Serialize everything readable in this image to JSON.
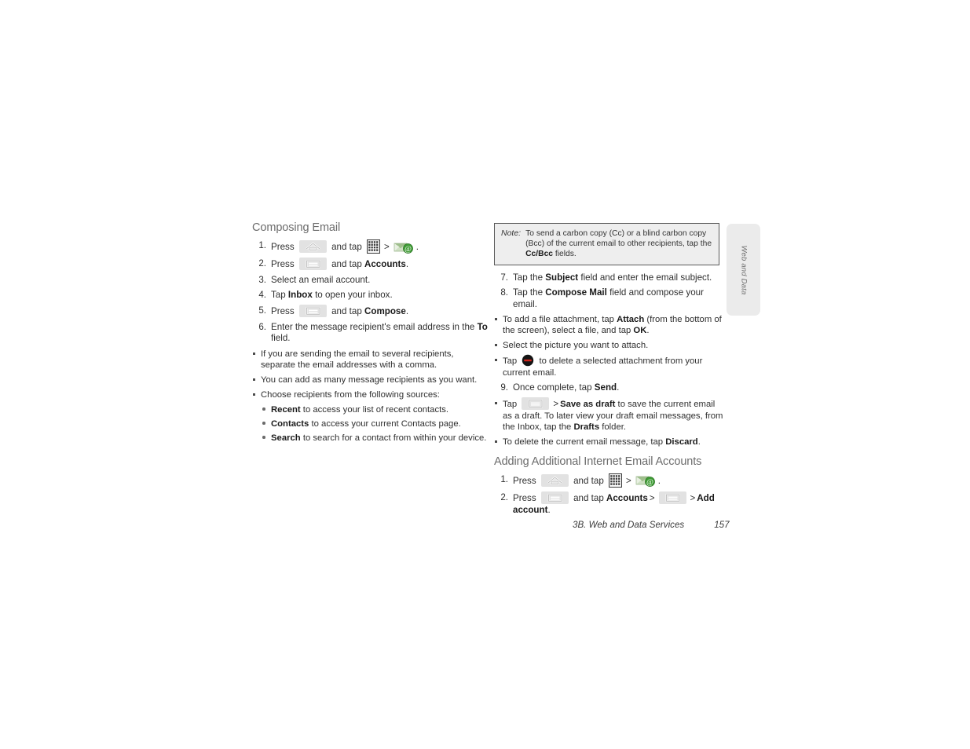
{
  "page": {
    "footer_section": "3B. Web and Data Services",
    "footer_page_number": "157",
    "side_tab_label": "Web and Data"
  },
  "left_column": {
    "heading": "Composing Email",
    "steps": [
      {
        "num": "1.",
        "parts": [
          {
            "t": "text",
            "v": "Press "
          },
          {
            "t": "icon",
            "v": "home-key-icon"
          },
          {
            "t": "text",
            "v": " and tap "
          },
          {
            "t": "icon",
            "v": "apps-grid-icon"
          },
          {
            "t": "gt",
            "v": ">"
          },
          {
            "t": "icon",
            "v": "email-icon"
          },
          {
            "t": "text",
            "v": "."
          }
        ]
      },
      {
        "num": "2.",
        "parts": [
          {
            "t": "text",
            "v": "Press "
          },
          {
            "t": "icon",
            "v": "menu-key-icon"
          },
          {
            "t": "text",
            "v": " and tap "
          },
          {
            "t": "bold",
            "v": "Accounts"
          },
          {
            "t": "text",
            "v": "."
          }
        ]
      },
      {
        "num": "3.",
        "parts": [
          {
            "t": "text",
            "v": "Select an email account."
          }
        ]
      },
      {
        "num": "4.",
        "parts": [
          {
            "t": "text",
            "v": "Tap "
          },
          {
            "t": "bold",
            "v": "Inbox"
          },
          {
            "t": "text",
            "v": " to open your inbox."
          }
        ]
      },
      {
        "num": "5.",
        "parts": [
          {
            "t": "text",
            "v": "Press "
          },
          {
            "t": "icon",
            "v": "menu-key-icon"
          },
          {
            "t": "text",
            "v": " and tap "
          },
          {
            "t": "bold",
            "v": "Compose"
          },
          {
            "t": "text",
            "v": "."
          }
        ]
      },
      {
        "num": "6.",
        "parts": [
          {
            "t": "text",
            "v": "Enter the message recipient's email address in the "
          },
          {
            "t": "bold",
            "v": "To"
          },
          {
            "t": "text",
            "v": " field."
          }
        ]
      }
    ],
    "step6_bullets": [
      {
        "parts": [
          {
            "t": "text",
            "v": "If you are sending the email to several recipients, separate the email addresses with a comma."
          }
        ]
      },
      {
        "parts": [
          {
            "t": "text",
            "v": "You can add as many message recipients as you want."
          }
        ]
      },
      {
        "parts": [
          {
            "t": "text",
            "v": "Choose recipients from the following sources:"
          }
        ]
      }
    ],
    "sources": [
      {
        "parts": [
          {
            "t": "bold",
            "v": "Recent"
          },
          {
            "t": "text",
            "v": " to access your list of recent contacts."
          }
        ]
      },
      {
        "parts": [
          {
            "t": "bold",
            "v": "Contacts"
          },
          {
            "t": "text",
            "v": " to access your current Contacts page."
          }
        ]
      },
      {
        "parts": [
          {
            "t": "bold",
            "v": "Search"
          },
          {
            "t": "text",
            "v": " to search for a contact from within your device."
          }
        ]
      }
    ]
  },
  "right_column": {
    "note": {
      "label": "Note:",
      "parts": [
        {
          "t": "text",
          "v": "To send a carbon copy (Cc) or a blind carbon copy (Bcc) of the current email to other recipients, tap the "
        },
        {
          "t": "bold",
          "v": "Cc/Bcc"
        },
        {
          "t": "text",
          "v": " fields."
        }
      ]
    },
    "steps": [
      {
        "num": "7.",
        "parts": [
          {
            "t": "text",
            "v": "Tap the "
          },
          {
            "t": "bold",
            "v": "Subject"
          },
          {
            "t": "text",
            "v": " field and enter the email subject."
          }
        ]
      },
      {
        "num": "8.",
        "parts": [
          {
            "t": "text",
            "v": "Tap the "
          },
          {
            "t": "bold",
            "v": "Compose Mail"
          },
          {
            "t": "text",
            "v": " field and compose your email."
          }
        ]
      }
    ],
    "step8_bullets": [
      {
        "parts": [
          {
            "t": "text",
            "v": "To add a file attachment, tap "
          },
          {
            "t": "bold",
            "v": "Attach"
          },
          {
            "t": "text",
            "v": " (from the bottom of the screen), select a file, and tap "
          },
          {
            "t": "bold",
            "v": "OK"
          },
          {
            "t": "text",
            "v": "."
          }
        ]
      },
      {
        "parts": [
          {
            "t": "text",
            "v": "Select the picture you want to attach."
          }
        ]
      },
      {
        "parts": [
          {
            "t": "text",
            "v": "Tap "
          },
          {
            "t": "icon",
            "v": "delete-attachment-icon"
          },
          {
            "t": "text",
            "v": " to delete a selected attachment from your current email."
          }
        ]
      }
    ],
    "step9": {
      "num": "9.",
      "parts": [
        {
          "t": "text",
          "v": "Once complete, tap "
        },
        {
          "t": "bold",
          "v": "Send"
        },
        {
          "t": "text",
          "v": "."
        }
      ]
    },
    "step9_bullets": [
      {
        "parts": [
          {
            "t": "text",
            "v": "Tap "
          },
          {
            "t": "icon",
            "v": "menu-key-icon"
          },
          {
            "t": "gt",
            "v": ">"
          },
          {
            "t": "bold",
            "v": "Save as draft"
          },
          {
            "t": "text",
            "v": " to save the current email as a draft. To later view your draft email messages, from the Inbox, tap the "
          },
          {
            "t": "bold",
            "v": "Drafts"
          },
          {
            "t": "text",
            "v": " folder."
          }
        ]
      },
      {
        "parts": [
          {
            "t": "text",
            "v": "To delete the current email message, tap "
          },
          {
            "t": "bold",
            "v": "Discard"
          },
          {
            "t": "text",
            "v": "."
          }
        ]
      }
    ],
    "heading2": "Adding Additional Internet Email Accounts",
    "steps2": [
      {
        "num": "1.",
        "parts": [
          {
            "t": "text",
            "v": "Press "
          },
          {
            "t": "icon",
            "v": "home-key-icon"
          },
          {
            "t": "text",
            "v": " and tap "
          },
          {
            "t": "icon",
            "v": "apps-grid-icon"
          },
          {
            "t": "gt",
            "v": ">"
          },
          {
            "t": "icon",
            "v": "email-icon"
          },
          {
            "t": "text",
            "v": "."
          }
        ]
      },
      {
        "num": "2.",
        "parts": [
          {
            "t": "text",
            "v": "Press "
          },
          {
            "t": "icon",
            "v": "menu-key-icon"
          },
          {
            "t": "text",
            "v": " and tap "
          },
          {
            "t": "bold",
            "v": "Accounts"
          },
          {
            "t": "gt",
            "v": ">"
          },
          {
            "t": "icon",
            "v": "menu-key-icon"
          },
          {
            "t": "gt",
            "v": ">"
          },
          {
            "t": "bold",
            "v": "Add account"
          },
          {
            "t": "text",
            "v": "."
          }
        ]
      }
    ]
  },
  "colors": {
    "heading_gray": "#6c6c6c",
    "body_text": "#2f2f2f",
    "note_bg": "#eeeeee",
    "note_border": "#5a5a5a",
    "key_icon_bg": "#e2e2e2",
    "email_icon_green": "#3f9c35",
    "delete_icon_red": "#d0241b",
    "side_tab_bg": "#ebebeb"
  }
}
